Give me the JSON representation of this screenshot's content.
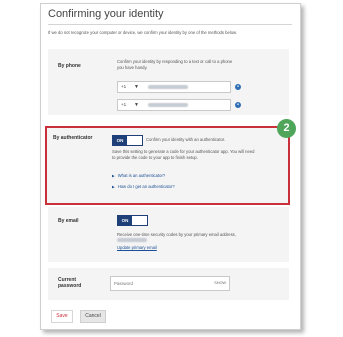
{
  "page": {
    "title": "Confirming your identity",
    "intro": "If we do not recognize your computer or device, we confirm your identity by one of the methods below."
  },
  "phone": {
    "label": "By phone",
    "description": "Confirm your identity by responding to a text or call to a phone you have handy.",
    "rows": [
      {
        "country_code": "+1",
        "caret": "▼",
        "number": "(blurred)",
        "icon": "info-icon"
      },
      {
        "country_code": "+1",
        "caret": "▼",
        "number": "(blurred)",
        "icon": "info-icon"
      }
    ]
  },
  "authenticator": {
    "label": "By authenticator",
    "toggle_state": "ON",
    "toggle_text": "Confirm your identity with an authenticator.",
    "description": "Save this setting to generate a code for your authenticator app. You will need to provide the code to your app to finish setup.",
    "link1": "What is an authenticator?",
    "link2": "How do I get an authenticator?",
    "badge": "2",
    "highlight_color": "#c8303a",
    "badge_color": "#4fa55a"
  },
  "email": {
    "label": "By email",
    "toggle_state": "ON",
    "description_prefix": "Receive one-time security codes by your primary email address,",
    "update_link": "Update primary email"
  },
  "password": {
    "label_line1": "Current",
    "label_line2": "password",
    "placeholder": "Password",
    "show_label": "SHOW"
  },
  "actions": {
    "save_label": "Save",
    "cancel_label": "Cancel"
  },
  "colors": {
    "accent_dark_blue": "#1f3f78",
    "link_blue": "#1a4e95"
  }
}
